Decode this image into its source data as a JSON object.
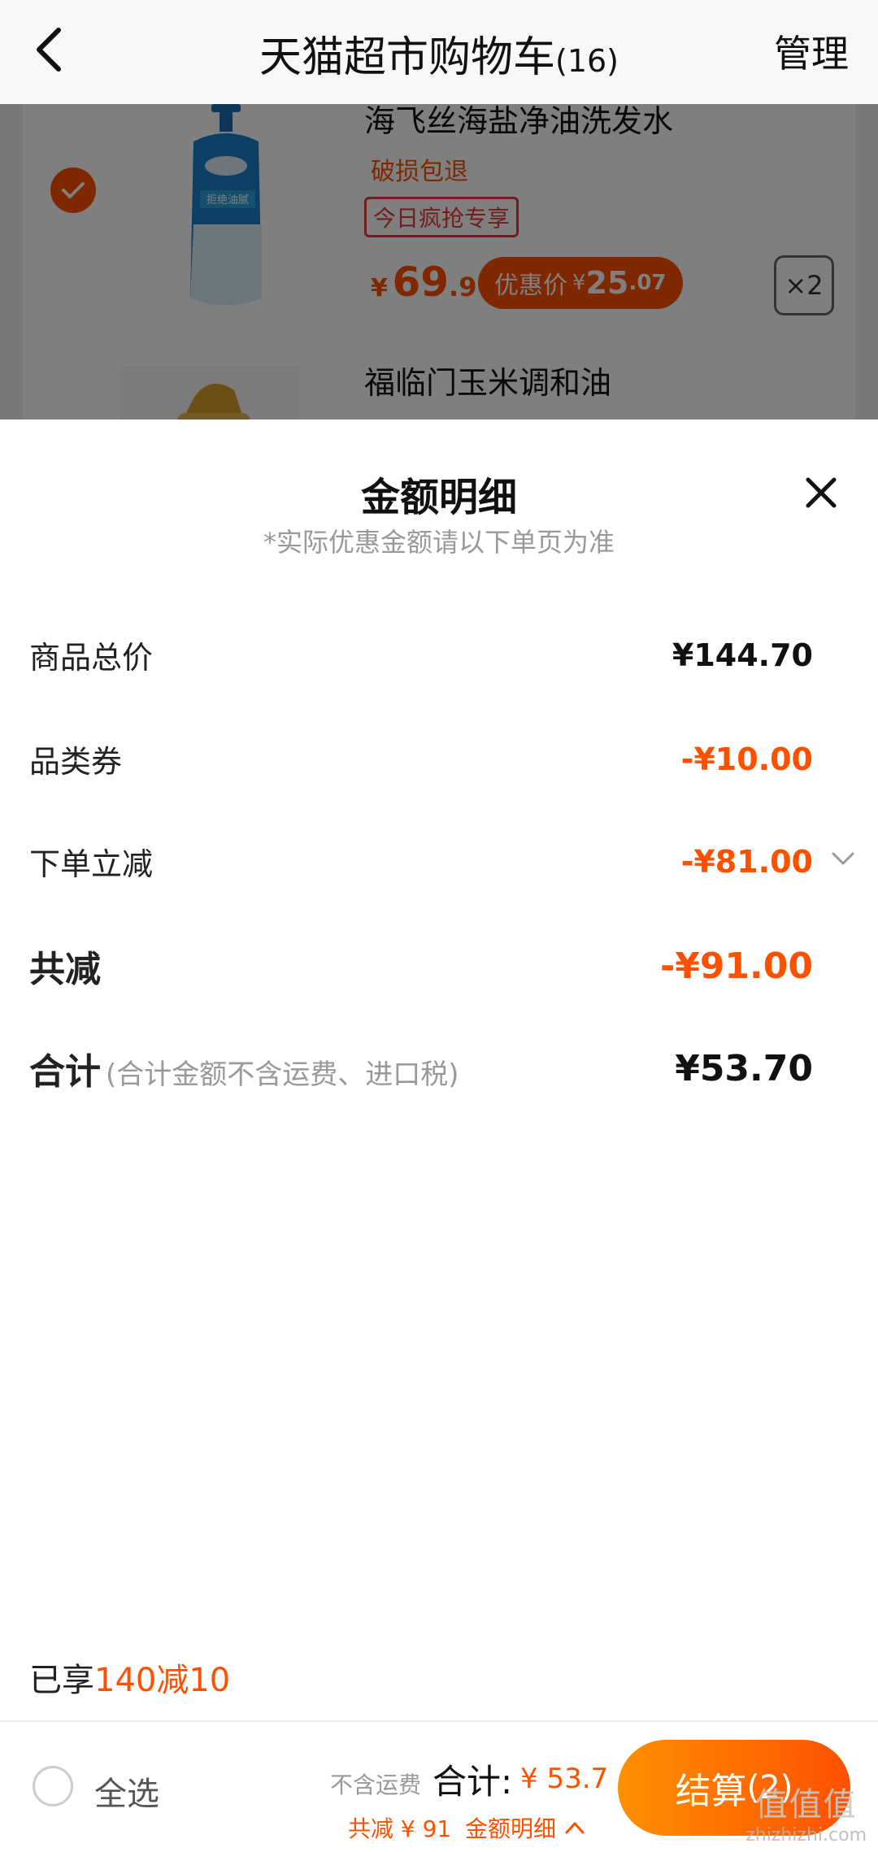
{
  "header": {
    "title": "天猫超市购物车",
    "count": "(16)",
    "manage_label": "管理"
  },
  "cart": {
    "item1": {
      "title": "海飞丝海盐净油洗发水",
      "tag_return": "破损包退",
      "tag_promo": "今日疯抢专享",
      "price_symbol": "¥",
      "price_int": "69",
      "price_dec": ".9",
      "promo_label": "优惠价",
      "promo_symbol": "¥",
      "promo_int": "25",
      "promo_dec": ".07",
      "qty": "×2",
      "image_text": "拒绝油腻"
    },
    "item2": {
      "title": "福临门玉米调和油"
    }
  },
  "sheet": {
    "title": "金额明细",
    "subtitle": "*实际优惠金额请以下单页为准",
    "rows": [
      {
        "label": "商品总价",
        "value": "¥144.70"
      },
      {
        "label": "品类券",
        "value": "-¥10.00"
      },
      {
        "label": "下单立减",
        "value": "-¥81.00"
      },
      {
        "label": "共减",
        "value": "-¥91.00"
      },
      {
        "label": "合计",
        "note": "(合计金额不含运费、进口税)",
        "value": "¥53.70"
      }
    ],
    "enjoyed_prefix": "已享",
    "enjoyed_highlight": "140减10"
  },
  "bottom_bar": {
    "select_all": "全选",
    "shipping_note": "不含运费",
    "total_label": "合计:",
    "total_value": "¥ 53.7",
    "discount_text": "共减 ¥ 91",
    "detail_link": "金额明细",
    "checkout_label": "结算",
    "checkout_count": "(2)"
  },
  "watermark": {
    "main": "值值值",
    "sub": "zhizhizhi.com"
  },
  "colors": {
    "accent": "#ff5000",
    "accent_gradient_start": "#ff9000",
    "muted": "#999999"
  }
}
